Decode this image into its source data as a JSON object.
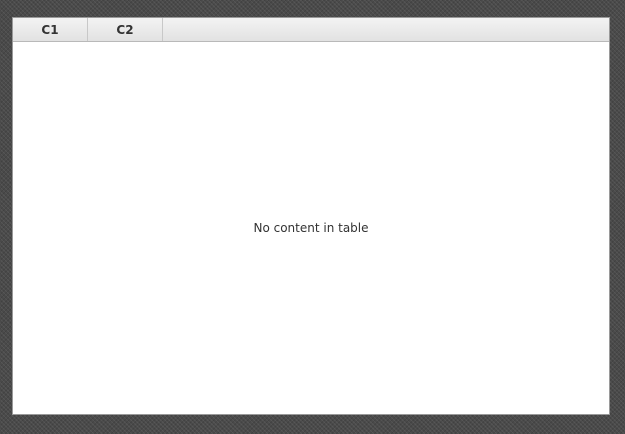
{
  "table": {
    "columns": [
      {
        "label": "C1"
      },
      {
        "label": "C2"
      }
    ],
    "rows": [],
    "placeholder": "No content in table"
  }
}
